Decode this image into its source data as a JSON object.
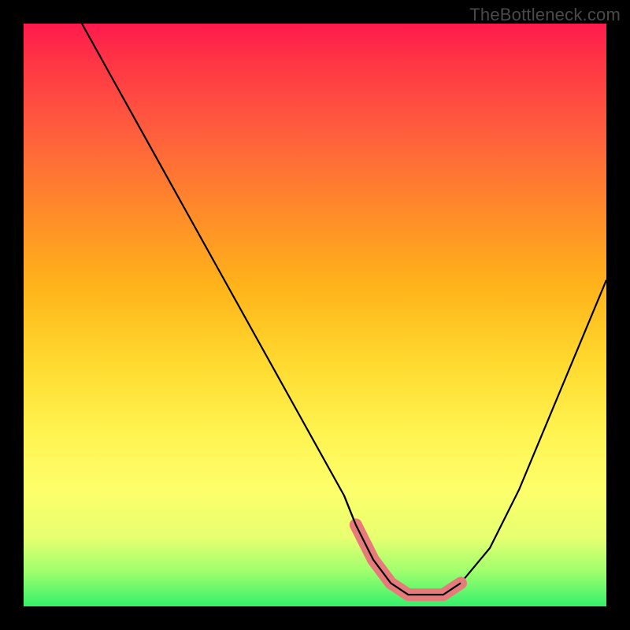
{
  "watermark": {
    "text": "TheBottleneck.com"
  },
  "chart_data": {
    "type": "line",
    "title": "",
    "xlabel": "",
    "ylabel": "",
    "xlim": [
      0,
      100
    ],
    "ylim": [
      0,
      100
    ],
    "series": [
      {
        "name": "bottleneck-curve",
        "x": [
          10,
          15,
          20,
          25,
          30,
          35,
          40,
          45,
          50,
          55,
          57,
          60,
          63,
          66,
          69,
          72,
          75,
          80,
          85,
          90,
          95,
          100
        ],
        "values": [
          100,
          91,
          82,
          73,
          64,
          55,
          46,
          37,
          28,
          19,
          14,
          8,
          4,
          2,
          2,
          2,
          4,
          10,
          20,
          32,
          44,
          56
        ]
      },
      {
        "name": "highlight-band",
        "x": [
          57,
          60,
          63,
          66,
          69,
          72,
          75
        ],
        "values": [
          14,
          8,
          4,
          2,
          2,
          2,
          4
        ]
      }
    ],
    "colors": {
      "curve": "#000000",
      "highlight": "#e77b7b"
    }
  }
}
